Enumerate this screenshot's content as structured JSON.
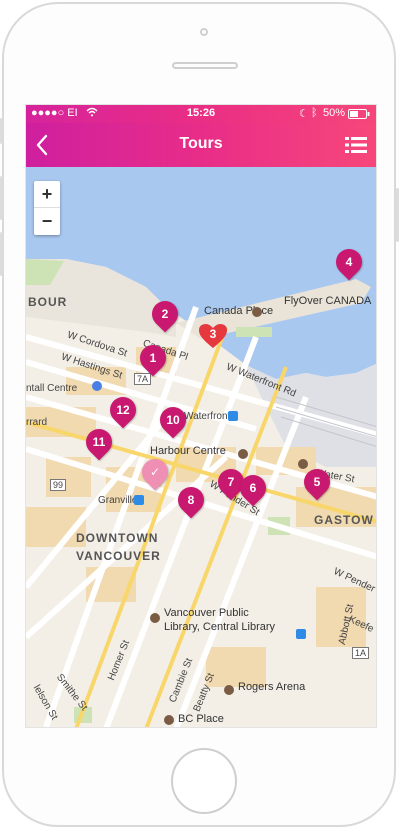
{
  "status_bar": {
    "carrier": "●●●●○ EI",
    "time": "15:26",
    "battery": "50%"
  },
  "nav": {
    "title": "Tours",
    "back_icon": "chevron-left-icon",
    "list_icon": "list-icon"
  },
  "map": {
    "zoom_in": "+",
    "zoom_out": "−",
    "labels": {
      "harbour": "BOUR",
      "canada_place": "Canada Place",
      "flyover": "FlyOver CANADA",
      "w_cordova": "W Cordova St",
      "w_hastings": "W Hastings St",
      "canada_pl": "Canada Pl",
      "w_waterfront": "W Waterfront Rd",
      "waterfront": "Waterfront",
      "harbour_centre": "Harbour Centre",
      "water_st": "Water St",
      "gastown": "GASTOW",
      "w_pender": "W Pender St",
      "granville": "Granville",
      "downtown": "DOWNTOWN",
      "vancouver": "VANCOUVER",
      "centre": "ntall Centre",
      "burrard": "rrard",
      "route_7a": "7A",
      "route_99": "99",
      "w_pender_2": "W Pender",
      "abbott": "Abbott St",
      "keefer": "Keefe",
      "library_1": "Vancouver Public",
      "library_2": "Library, Central Library",
      "homer": "Homer St",
      "smithe": "Smithe St",
      "cambie": "Cambie St",
      "beatty": "Beatty St",
      "rogers": "Rogers Arena",
      "nelson": "lelson St",
      "bc_place": "BC Place",
      "route_1a": "1A"
    },
    "pins": [
      {
        "id": "pin-1",
        "label": "1"
      },
      {
        "id": "pin-2",
        "label": "2"
      },
      {
        "id": "pin-3",
        "label": "3"
      },
      {
        "id": "pin-4",
        "label": "4"
      },
      {
        "id": "pin-5",
        "label": "5"
      },
      {
        "id": "pin-6",
        "label": "6"
      },
      {
        "id": "pin-7",
        "label": "7"
      },
      {
        "id": "pin-8",
        "label": "8"
      },
      {
        "id": "pin-10",
        "label": "10"
      },
      {
        "id": "pin-11",
        "label": "11"
      },
      {
        "id": "pin-12",
        "label": "12"
      }
    ],
    "colors": {
      "pin": "#c8186f",
      "pin_active": "#e5393f",
      "water": "#a9c8f0",
      "park": "#cde3b5",
      "building": "#f1d9b0"
    }
  }
}
